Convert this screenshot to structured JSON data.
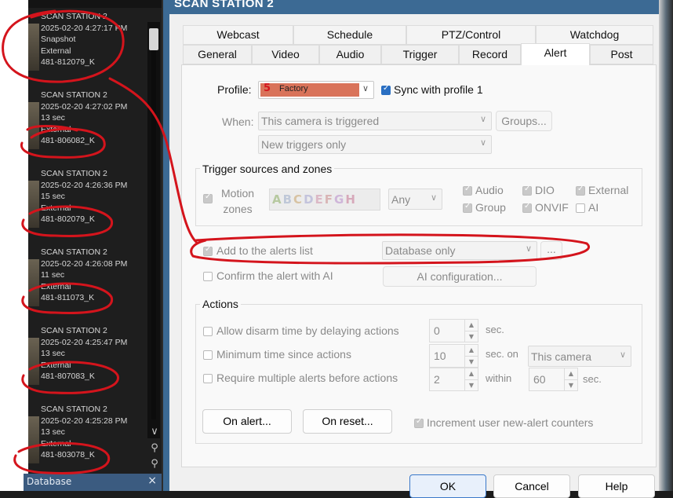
{
  "clips_panel": {
    "clips": [
      {
        "lines": [
          "SCAN STATION 2",
          "2025-02-20 4:27:17 PM",
          "Snapshot",
          "External",
          "481-812079_K"
        ]
      },
      {
        "lines": [
          "SCAN STATION 2",
          "2025-02-20 4:27:02 PM",
          "13 sec",
          "External",
          "481-806082_K"
        ]
      },
      {
        "lines": [
          "SCAN STATION 2",
          "2025-02-20 4:26:36 PM",
          "15 sec",
          "External",
          "481-802079_K"
        ]
      },
      {
        "lines": [
          "SCAN STATION 2",
          "2025-02-20 4:26:08 PM",
          "11 sec",
          "External",
          "481-811073_K"
        ]
      },
      {
        "lines": [
          "SCAN STATION 2",
          "2025-02-20 4:25:47 PM",
          "13 sec",
          "External",
          "481-807083_K"
        ]
      },
      {
        "lines": [
          "SCAN STATION 2",
          "2025-02-20 4:25:28 PM",
          "13 sec",
          "External",
          "481-803078_K"
        ]
      }
    ],
    "footer_label": "Database",
    "close_glyph": "×"
  },
  "dialog": {
    "title": "SCAN STATION 2",
    "tabs_row1": [
      "Webcast",
      "Schedule",
      "PTZ/Control",
      "Watchdog"
    ],
    "tabs_row2": [
      "General",
      "Video",
      "Audio",
      "Trigger",
      "Record",
      "Alert",
      "Post"
    ],
    "active_tab": "Alert",
    "profile": {
      "label": "Profile:",
      "badge": "5",
      "value": "Factory",
      "sync_label": "Sync with profile 1"
    },
    "when": {
      "label": "When:",
      "value": "This camera is triggered",
      "groups_button": "Groups...",
      "sub_value": "New triggers only"
    },
    "trigger_sources": {
      "title": "Trigger sources and zones",
      "motion_zones_label": [
        "Motion",
        "zones"
      ],
      "zone_letters": [
        "A",
        "B",
        "C",
        "D",
        "E",
        "F",
        "G",
        "H"
      ],
      "any_value": "Any",
      "options": [
        {
          "label": "Audio",
          "checked": true
        },
        {
          "label": "DIO",
          "checked": true
        },
        {
          "label": "External",
          "checked": true
        },
        {
          "label": "Group",
          "checked": true
        },
        {
          "label": "ONVIF",
          "checked": true
        },
        {
          "label": "AI",
          "checked": false
        }
      ]
    },
    "alerts_list": {
      "label": "Add to the alerts list",
      "value": "Database only",
      "more_button": "..."
    },
    "confirm_ai": {
      "label": "Confirm the alert with AI",
      "button": "AI configuration..."
    },
    "actions": {
      "title": "Actions",
      "disarm": {
        "label": "Allow disarm time by delaying actions",
        "value": "0",
        "unit": "sec."
      },
      "min_time": {
        "label": "Minimum time since actions",
        "value": "10",
        "unit": "sec. on",
        "target": "This camera"
      },
      "multiple": {
        "label": "Require multiple alerts before actions",
        "value": "2",
        "within_label": "within",
        "within_value": "60",
        "unit": "sec."
      },
      "on_alert_button": "On alert...",
      "on_reset_button": "On reset...",
      "increment_label": "Increment user new-alert counters"
    },
    "footer_buttons": [
      "OK",
      "Cancel",
      "Help"
    ]
  },
  "colors": {
    "annotation_red": "#d4141c",
    "profile_badge": "#d9735a",
    "title_bar": "#3c6a94",
    "check_blue": "#2a6fc2"
  }
}
